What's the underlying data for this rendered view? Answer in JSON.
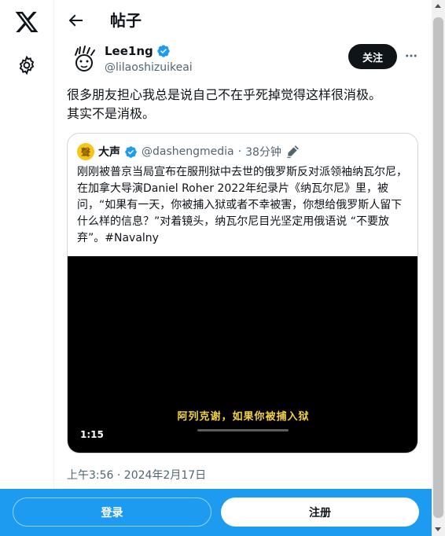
{
  "header": {
    "title": "帖子"
  },
  "post": {
    "author_name": "Lee1ng",
    "author_handle": "@lilaoshizuikeai",
    "follow_label": "关注",
    "text": "很多朋友担心我总是说自己不在乎死掉觉得这样很消极。\n其实不是消极。",
    "timestamp": "上午3:56 · 2024年2月17日"
  },
  "quote": {
    "avatar_glyph": "聲",
    "name": "大声",
    "handle": "@dashengmedia",
    "separator": "·",
    "time": "38分钟",
    "text": "刚刚被普京当局宣布在服刑狱中去世的俄罗斯反对派领袖纳瓦尔尼，在加拿大导演Daniel Roher 2022年纪录片《纳瓦尔尼》里，被问，“如果有一天，你被捕入狱或者不幸被害，你想给俄罗斯人留下什么样的信息？”对着镜头，纳瓦尔尼目光坚定用俄语说 “不要放弃”。#Navalny",
    "video": {
      "subtitle": "阿列克谢，如果你被捕入狱",
      "duration": "1:15"
    }
  },
  "bottom_bar": {
    "login_label": "登录",
    "signup_label": "注册"
  },
  "colors": {
    "accent": "#1d9bf0",
    "text": "#0f1419",
    "secondary": "#536471"
  }
}
